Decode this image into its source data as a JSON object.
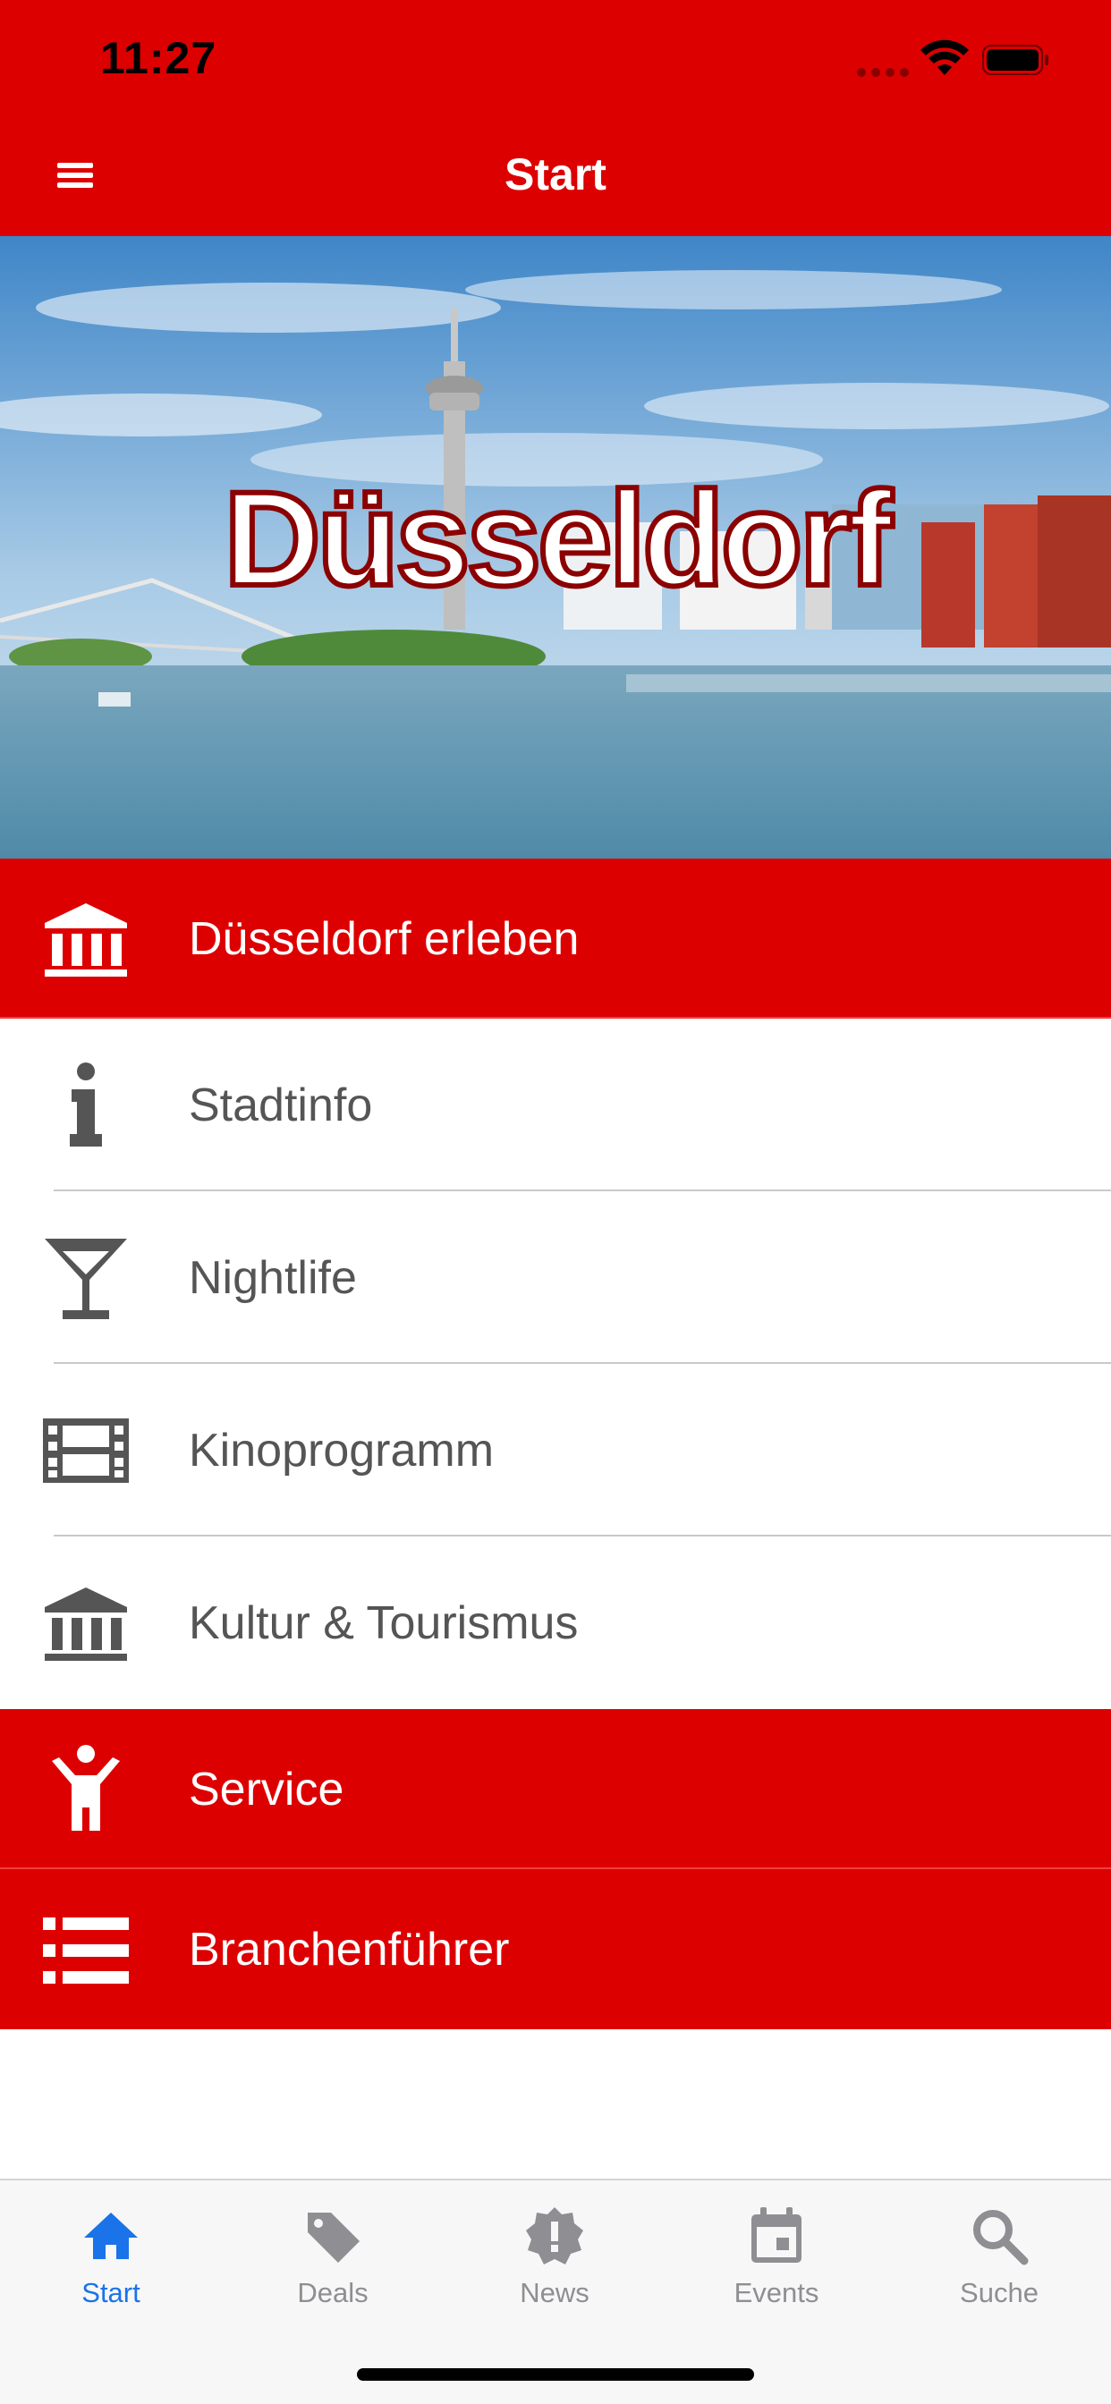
{
  "status": {
    "time": "11:27"
  },
  "nav": {
    "title": "Start"
  },
  "hero": {
    "logo_text": "Düsseldorf"
  },
  "menu": {
    "items": [
      {
        "label": "Düsseldorf erleben",
        "icon": "museum-icon",
        "style": "red"
      },
      {
        "label": "Stadtinfo",
        "icon": "info-icon",
        "style": "white"
      },
      {
        "label": "Nightlife",
        "icon": "cocktail-glass-icon",
        "style": "white"
      },
      {
        "label": "Kinoprogramm",
        "icon": "film-strip-icon",
        "style": "white"
      },
      {
        "label": "Kultur & Tourismus",
        "icon": "museum-icon",
        "style": "white"
      },
      {
        "label": "Service",
        "icon": "person-icon",
        "style": "red"
      },
      {
        "label": "Branchenführer",
        "icon": "list-icon",
        "style": "red"
      }
    ]
  },
  "tabs": [
    {
      "label": "Start",
      "icon": "home-icon",
      "active": true
    },
    {
      "label": "Deals",
      "icon": "tag-icon",
      "active": false
    },
    {
      "label": "News",
      "icon": "alert-badge-icon",
      "active": false
    },
    {
      "label": "Events",
      "icon": "calendar-icon",
      "active": false
    },
    {
      "label": "Suche",
      "icon": "search-icon",
      "active": false
    }
  ],
  "colors": {
    "brand": "#DD0000",
    "active_tab": "#1a73e8",
    "inactive_tab": "#8e8e93",
    "row_text": "#555555"
  }
}
